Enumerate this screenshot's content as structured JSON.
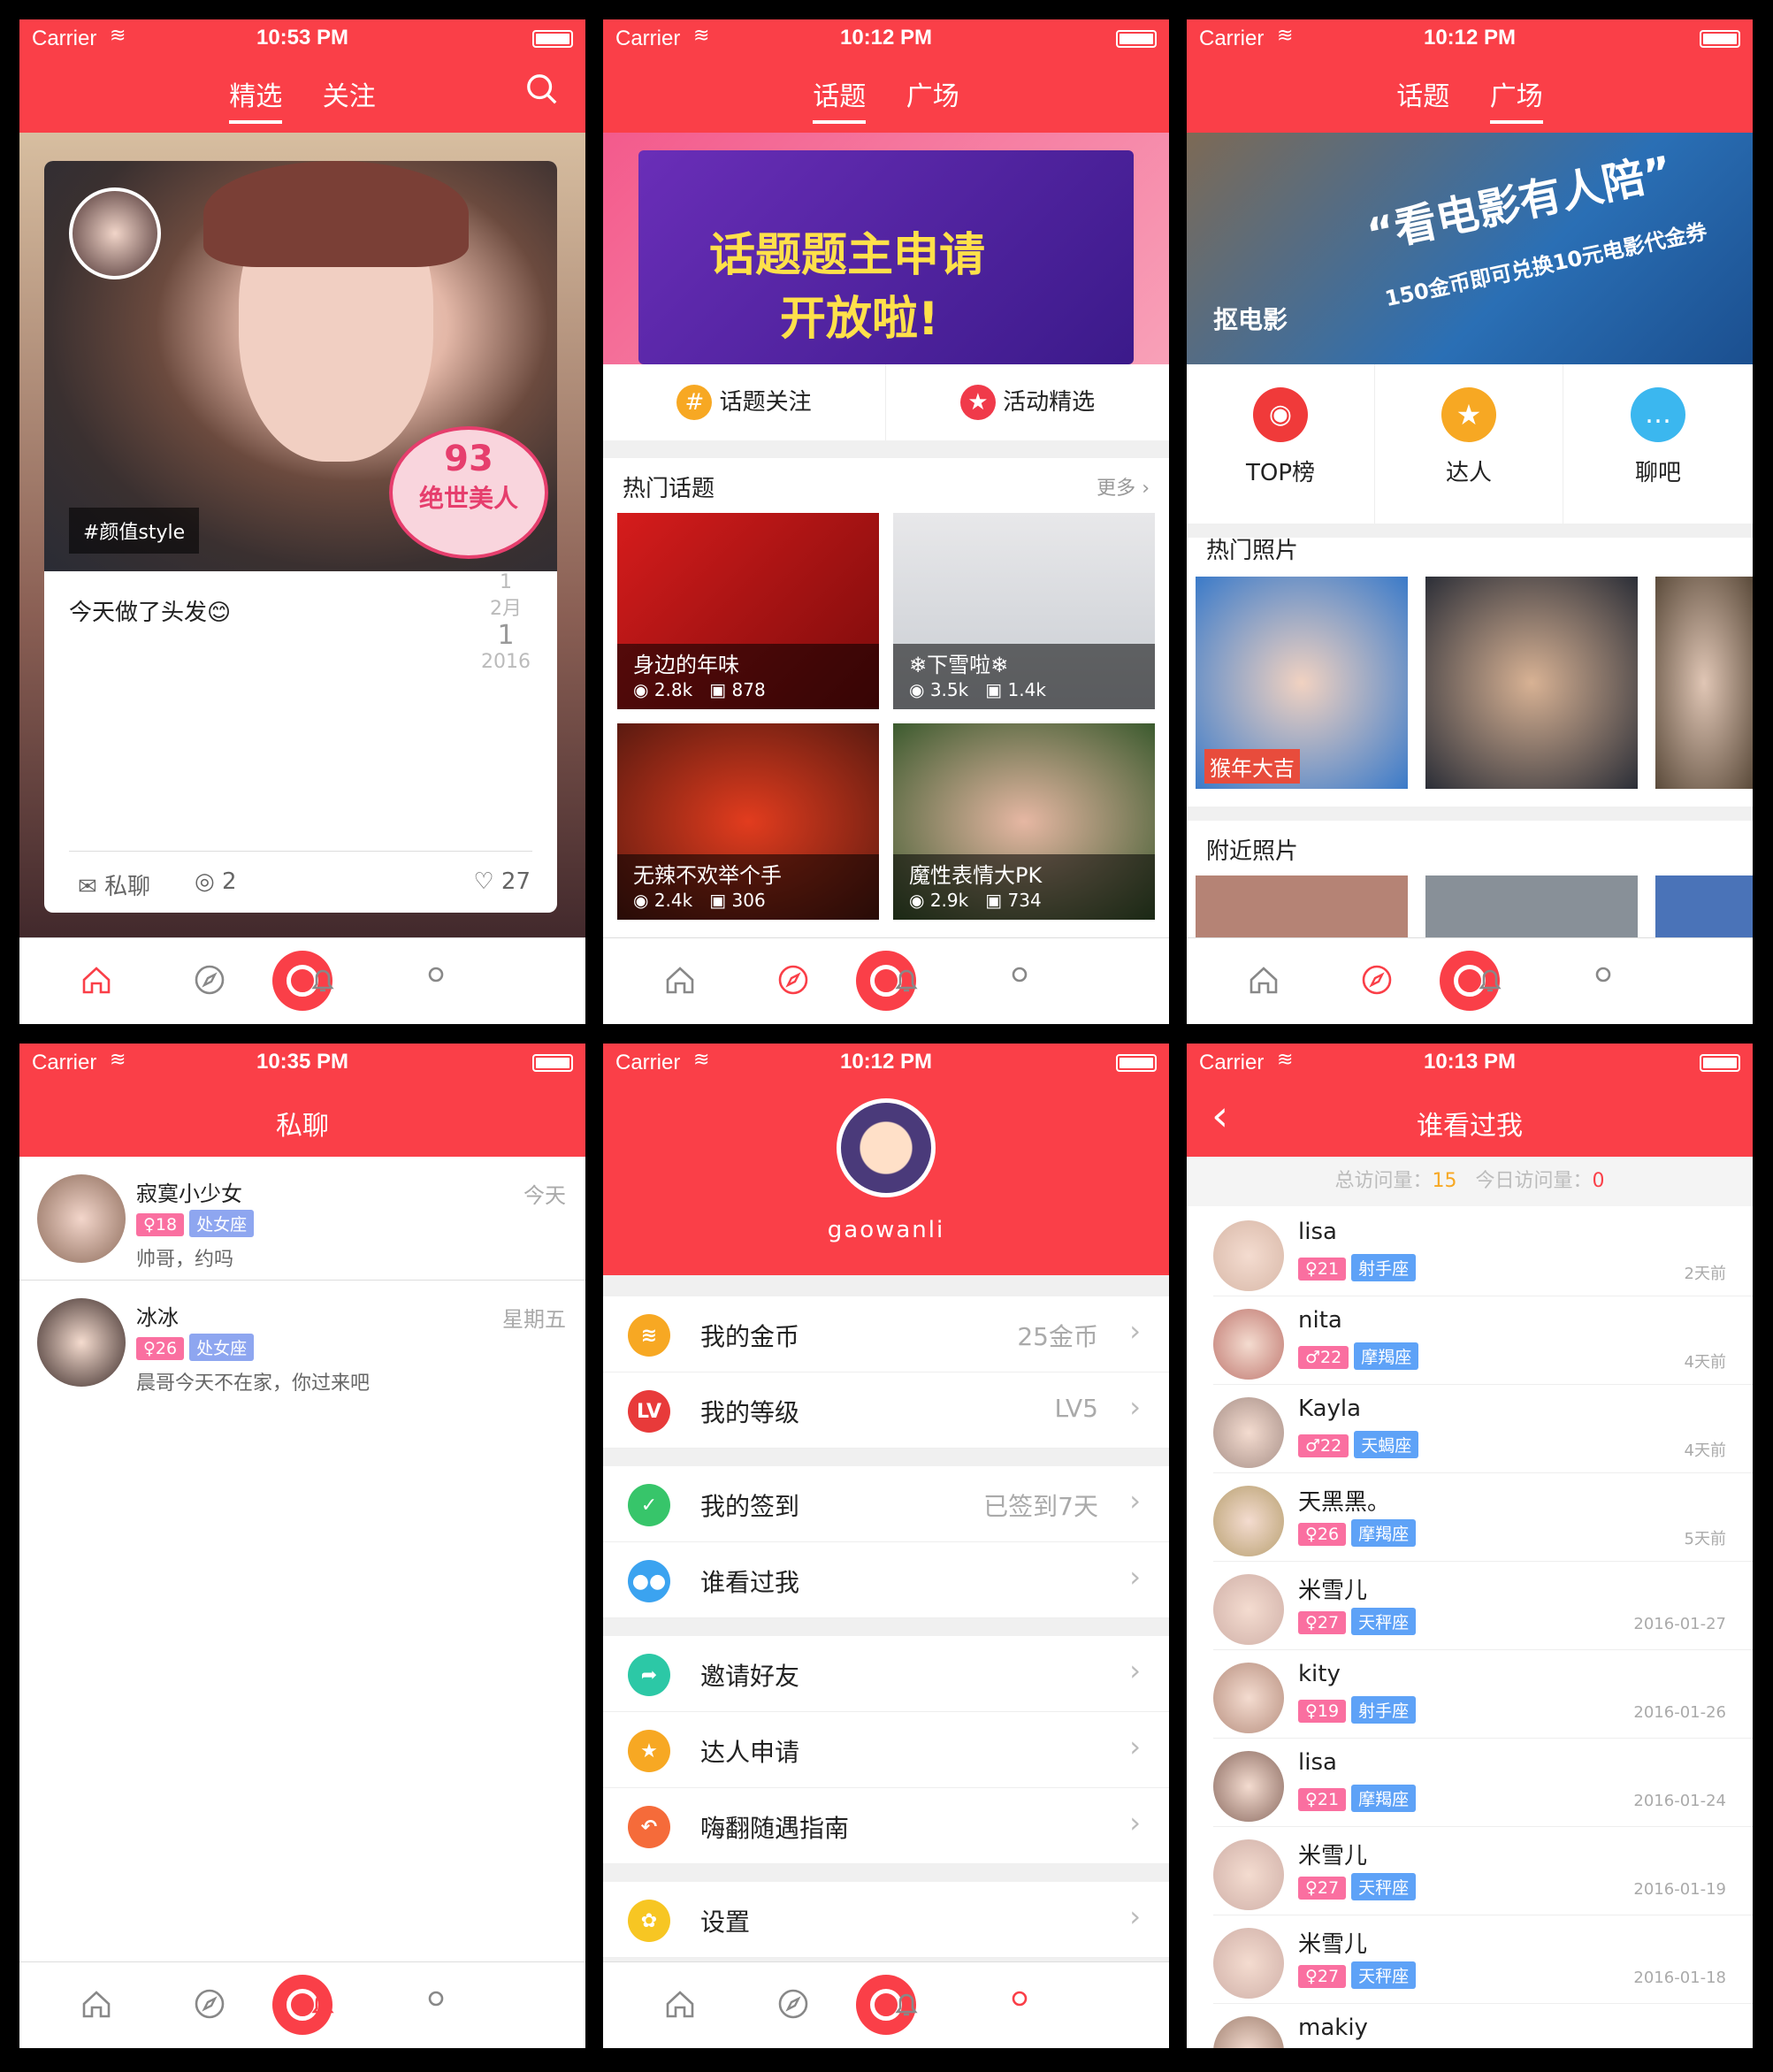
{
  "status": {
    "carrier": "Carrier",
    "wifi": "≋",
    "t1": "10:53 PM",
    "t2": "10:12 PM",
    "t3": "10:12 PM",
    "t4": "10:35 PM",
    "t5": "10:12 PM",
    "t6": "10:13 PM"
  },
  "s1": {
    "tab_a": "精选",
    "tab_b": "关注",
    "tag": "#颜值style",
    "text": "今天做了头发😊",
    "date_num1": "1",
    "date_month": "2月",
    "date_num2": "1",
    "date_year": "2016",
    "msg": "私聊",
    "comments": "2",
    "likes": "27",
    "badge_num": "93",
    "badge_text": "绝世美人"
  },
  "s2": {
    "tab_a": "话题",
    "tab_b": "广场",
    "banner_l1": "话题题主申请",
    "banner_l2": "开放啦!",
    "btn_a": "话题关注",
    "btn_b": "活动精选",
    "hot": "热门话题",
    "more": "更多",
    "topics": [
      {
        "name": "身边的年味",
        "views": "2.8k",
        "pics": "878"
      },
      {
        "name": "❄下雪啦❄",
        "views": "3.5k",
        "pics": "1.4k"
      },
      {
        "name": "无辣不欢举个手",
        "views": "2.4k",
        "pics": "306"
      },
      {
        "name": "魔性表情大PK",
        "views": "2.9k",
        "pics": "734"
      }
    ]
  },
  "s3": {
    "tab_a": "话题",
    "tab_b": "广场",
    "banner_l1": "“看电影有人陪”",
    "banner_l2": "150金币即可兑换10元电影代金券",
    "banner_brand": "抠电影",
    "icons": [
      "TOP榜",
      "达人",
      "聊吧"
    ],
    "hot": "热门照片",
    "near": "附近照片",
    "sticker": "猴年大吉"
  },
  "s4": {
    "title": "私聊",
    "chats": [
      {
        "name": "寂寞小少女",
        "age": "♀18",
        "sign": "处女座",
        "msg": "帅哥，约吗",
        "time": "今天"
      },
      {
        "name": "冰冰",
        "age": "♀26",
        "sign": "处女座",
        "msg": "晨哥今天不在家，你过来吧",
        "time": "星期五"
      }
    ]
  },
  "s5": {
    "username": "gaowanli",
    "rows": [
      {
        "t": "我的金币",
        "v": "25金币",
        "icon": "coin-icon",
        "c": "#f7a823",
        "g": "≋"
      },
      {
        "t": "我的等级",
        "v": "LV5",
        "icon": "level-icon",
        "c": "#e83a3a",
        "g": "LV"
      },
      {
        "t": "我的签到",
        "v": "已签到7天",
        "icon": "check-icon",
        "c": "#37c56a",
        "g": "✓"
      },
      {
        "t": "谁看过我",
        "v": "",
        "icon": "visitors-icon",
        "c": "#3ba3f0",
        "g": "●●"
      },
      {
        "t": "邀请好友",
        "v": "",
        "icon": "share-icon",
        "c": "#2cc8a6",
        "g": "➦"
      },
      {
        "t": "达人申请",
        "v": "",
        "icon": "star-icon",
        "c": "#f7a823",
        "g": "★"
      },
      {
        "t": "嗨翻随遇指南",
        "v": "",
        "icon": "guide-icon",
        "c": "#f56b3a",
        "g": "↶"
      },
      {
        "t": "设置",
        "v": "",
        "icon": "settings-icon",
        "c": "#f7c623",
        "g": "✿"
      }
    ]
  },
  "s6": {
    "title": "谁看过我",
    "total_label": "总访问量：",
    "total": "15",
    "today_label": "今日访问量：",
    "today": "0",
    "visitors": [
      {
        "n": "lisa",
        "a": "♀21",
        "s": "射手座",
        "t": "2天前",
        "c": "pink"
      },
      {
        "n": "nita",
        "a": "♂22",
        "s": "摩羯座",
        "t": "4天前",
        "c": "pink"
      },
      {
        "n": "Kayla",
        "a": "♂22",
        "s": "天蝎座",
        "t": "4天前",
        "c": "pink"
      },
      {
        "n": "天黑黑。",
        "a": "♀26",
        "s": "摩羯座",
        "t": "5天前",
        "c": "pink"
      },
      {
        "n": "米雪儿",
        "a": "♀27",
        "s": "天秤座",
        "t": "2016-01-27",
        "c": "pink"
      },
      {
        "n": "kity",
        "a": "♀19",
        "s": "射手座",
        "t": "2016-01-26",
        "c": "pink"
      },
      {
        "n": "lisa",
        "a": "♀21",
        "s": "摩羯座",
        "t": "2016-01-24",
        "c": "pink"
      },
      {
        "n": "米雪儿",
        "a": "♀27",
        "s": "天秤座",
        "t": "2016-01-19",
        "c": "pink"
      },
      {
        "n": "米雪儿",
        "a": "♀27",
        "s": "天秤座",
        "t": "2016-01-18",
        "c": "pink"
      },
      {
        "n": "makiy",
        "a": "",
        "s": "",
        "t": "",
        "c": "pink"
      }
    ]
  },
  "colors": {
    "accent": "#fa3f48"
  }
}
